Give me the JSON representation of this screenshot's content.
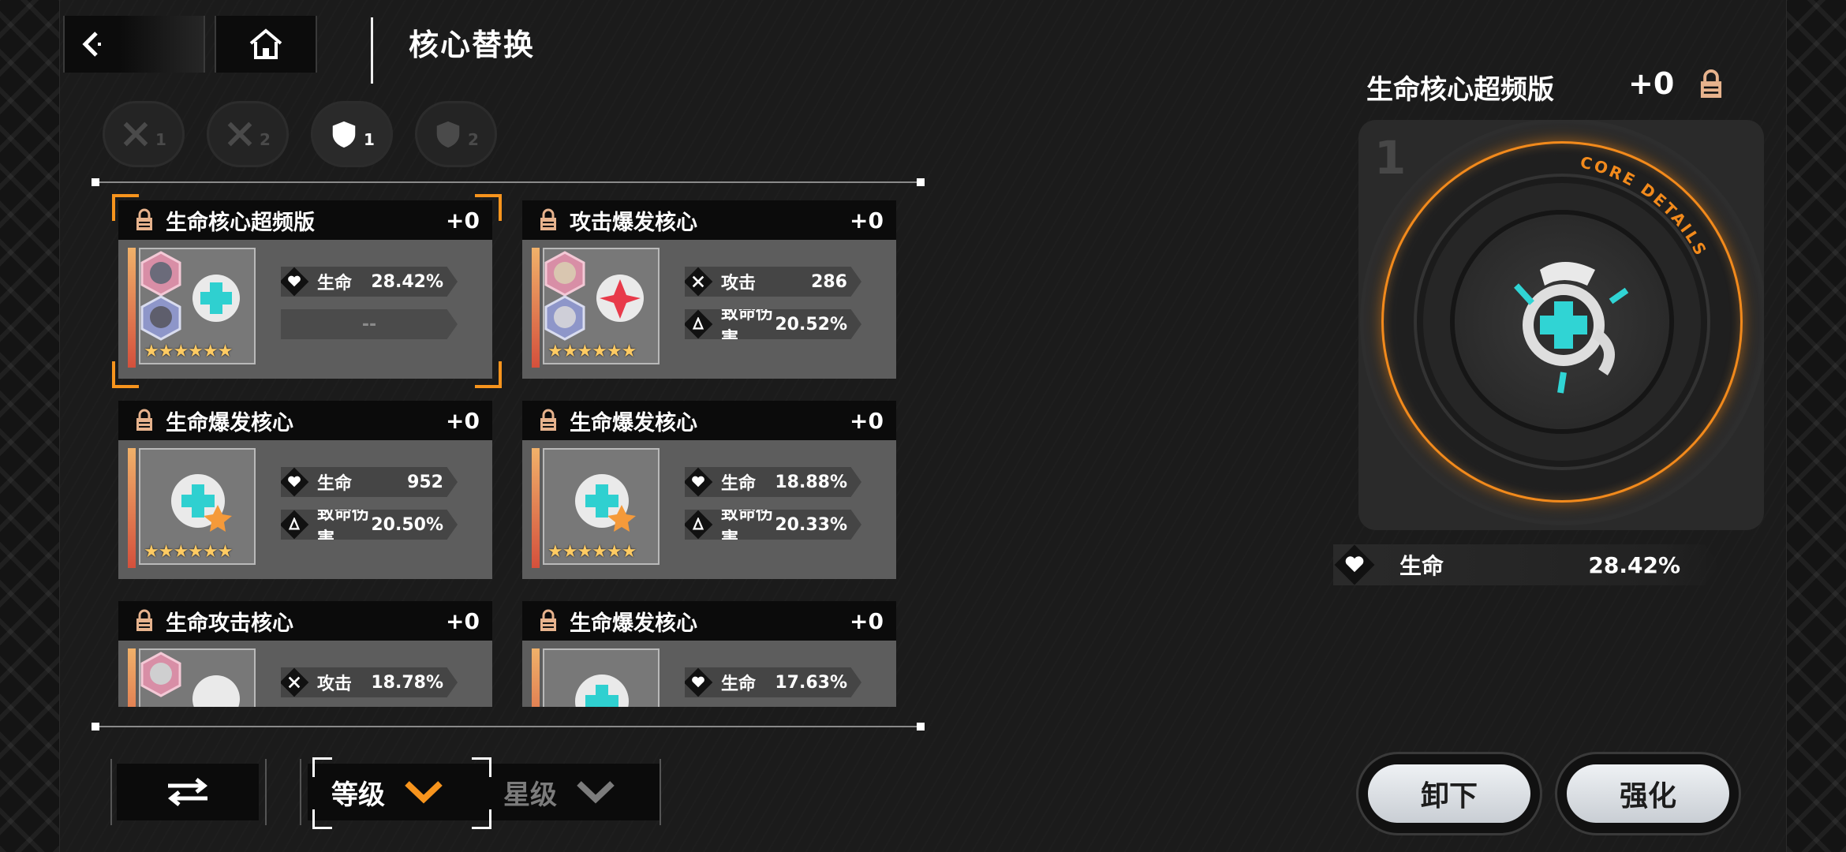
{
  "header": {
    "title": "核心替换"
  },
  "filter_tabs": [
    {
      "num": "1",
      "icon": "crossed-swords-icon",
      "active": false
    },
    {
      "num": "2",
      "icon": "crossed-swords-icon",
      "active": false
    },
    {
      "num": "1",
      "icon": "shield-icon",
      "active": true
    },
    {
      "num": "2",
      "icon": "shield-icon",
      "active": false
    }
  ],
  "cores": [
    {
      "name": "生命核心超频版",
      "plus": "+0",
      "stars": "★★★★★★",
      "selected": true,
      "stat1": {
        "icon": "heart-icon",
        "label": "生命",
        "value": "28.42%"
      },
      "stat2": {
        "label": "",
        "value": "--",
        "empty": true
      }
    },
    {
      "name": "攻击爆发核心",
      "plus": "+0",
      "stars": "★★★★★★",
      "stat1": {
        "icon": "swords-icon",
        "label": "攻击",
        "value": "286"
      },
      "stat2": {
        "icon": "crit-icon",
        "label": "致命伤害",
        "value": "20.52%"
      }
    },
    {
      "name": "生命爆发核心",
      "plus": "+0",
      "stars": "★★★★★★",
      "stat1": {
        "icon": "heart-icon",
        "label": "生命",
        "value": "952"
      },
      "stat2": {
        "icon": "crit-icon",
        "label": "致命伤害",
        "value": "20.50%"
      }
    },
    {
      "name": "生命爆发核心",
      "plus": "+0",
      "stars": "★★★★★★",
      "stat1": {
        "icon": "heart-icon",
        "label": "生命",
        "value": "18.88%"
      },
      "stat2": {
        "icon": "crit-icon",
        "label": "致命伤害",
        "value": "20.33%"
      }
    },
    {
      "name": "生命攻击核心",
      "plus": "+0",
      "stars": "★★★★★★",
      "stat1": {
        "icon": "swords-icon",
        "label": "攻击",
        "value": "18.78%"
      }
    },
    {
      "name": "生命爆发核心",
      "plus": "+0",
      "stars": "★★★★★★",
      "stat1": {
        "icon": "heart-icon",
        "label": "生命",
        "value": "17.63%"
      }
    }
  ],
  "sort": {
    "level_label": "等级",
    "star_label": "星级",
    "active": "level"
  },
  "detail": {
    "name": "生命核心超频版",
    "plus": "+0",
    "slot": "1",
    "ring_text": "CORE DETAILS",
    "stat": {
      "label": "生命",
      "value": "28.42%"
    }
  },
  "actions": {
    "unequip": "卸下",
    "enhance": "强化"
  },
  "colors": {
    "accent": "#f7941d",
    "card_body": "#5d5d5d",
    "card_head": "#0b0b0b",
    "star": "#ffcb63"
  }
}
